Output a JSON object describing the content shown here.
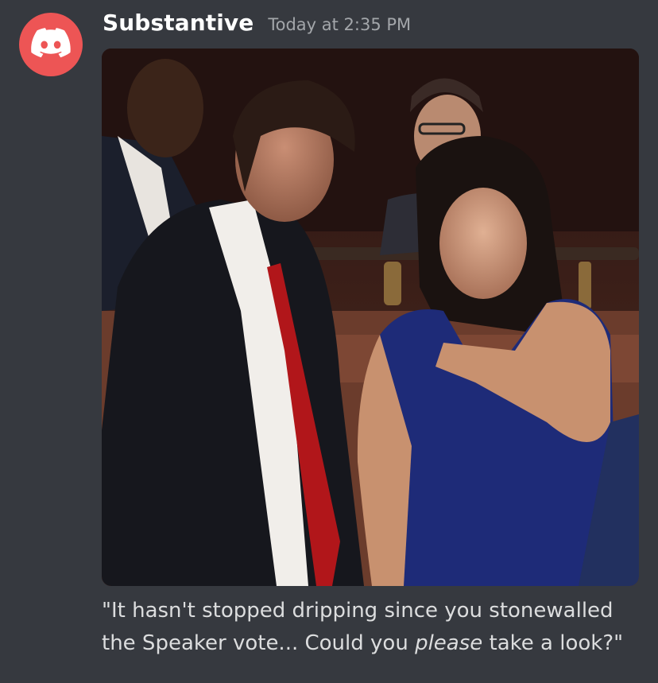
{
  "message": {
    "author": "Substantive",
    "timestamp": "Today at 2:35 PM",
    "avatar_icon": "discord-logo-icon",
    "avatar_color": "#ed5555",
    "attachment_icon": "image-attachment",
    "text_before": "\"It hasn't stopped dripping since you stonewalled the Speaker vote... Could you ",
    "text_emphasis": "please",
    "text_after": " take a look?\""
  },
  "colors": {
    "background": "#36393f",
    "username": "#ffffff",
    "timestamp": "#a3a6aa",
    "message_text": "#dcddde"
  }
}
